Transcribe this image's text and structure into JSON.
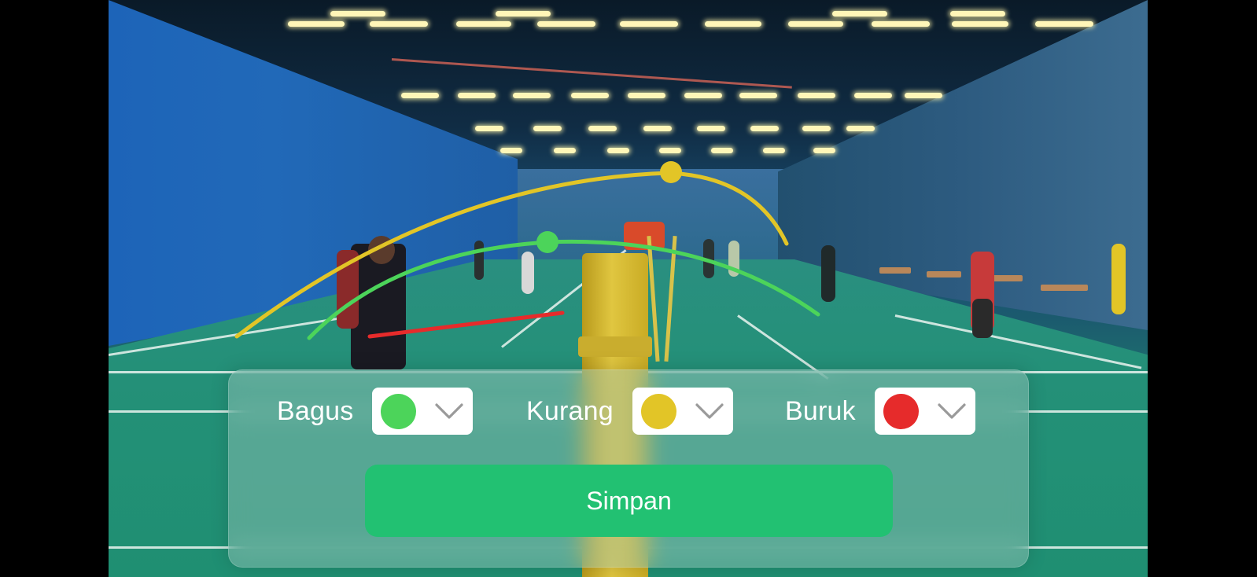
{
  "background": {
    "description_icon": "badminton-court-video-frame"
  },
  "trajectories": [
    {
      "name": "good",
      "color": "#4cd45a"
    },
    {
      "name": "fair",
      "color": "#e2c527"
    },
    {
      "name": "bad",
      "color": "#e62b2b"
    }
  ],
  "panel": {
    "pickers": [
      {
        "label": "Bagus",
        "color": "#4cd45a",
        "icon": "chevron-down-icon"
      },
      {
        "label": "Kurang",
        "color": "#e2c527",
        "icon": "chevron-down-icon"
      },
      {
        "label": "Buruk",
        "color": "#e62b2b",
        "icon": "chevron-down-icon"
      }
    ],
    "save_label": "Simpan",
    "save_color": "#22c172"
  }
}
